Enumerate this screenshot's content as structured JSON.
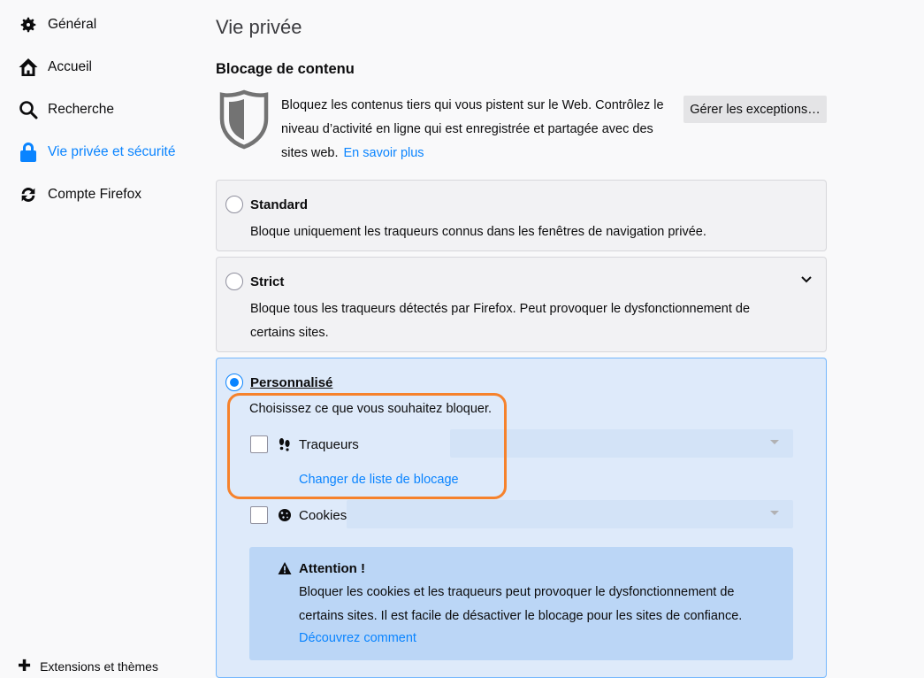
{
  "sidebar": {
    "items": [
      {
        "label": "Général",
        "icon": "gear-icon"
      },
      {
        "label": "Accueil",
        "icon": "home-icon"
      },
      {
        "label": "Recherche",
        "icon": "search-icon"
      },
      {
        "label": "Vie privée et sécurité",
        "icon": "lock-icon",
        "selected": true
      },
      {
        "label": "Compte Firefox",
        "icon": "sync-icon"
      }
    ],
    "bottom_label": "Extensions et thèmes"
  },
  "main": {
    "page_title": "Vie privée",
    "section_title": "Blocage de contenu",
    "description": "Bloquez les contenus tiers qui vous pistent sur le Web. Contrôlez le niveau d’activité en ligne qui est enregistrée et partagée avec des sites web.",
    "learn_more": "En savoir plus",
    "exceptions_button": "Gérer les exceptions…",
    "options": {
      "standard": {
        "label": "Standard",
        "description": "Bloque uniquement les traqueurs connus dans les fenêtres de navigation privée."
      },
      "strict": {
        "label": "Strict",
        "description": "Bloque tous les traqueurs détectés par Firefox. Peut provoquer le dysfonctionnement de certains sites."
      },
      "custom": {
        "label": "Personnalisé",
        "prompt": "Choisissez ce que vous souhaitez bloquer.",
        "trackers_label": "Traqueurs",
        "change_blocklist": "Changer de liste de blocage",
        "cookies_label": "Cookies"
      }
    },
    "warning": {
      "title": "Attention !",
      "text": "Bloquer les cookies et les traqueurs peut provoquer le dysfonctionnement de certains sites. Il est facile de désactiver le blocage pour les sites de confiance.",
      "link": "Découvrez comment"
    }
  },
  "colors": {
    "accent": "#0a84ff",
    "highlight": "#f6822c"
  }
}
